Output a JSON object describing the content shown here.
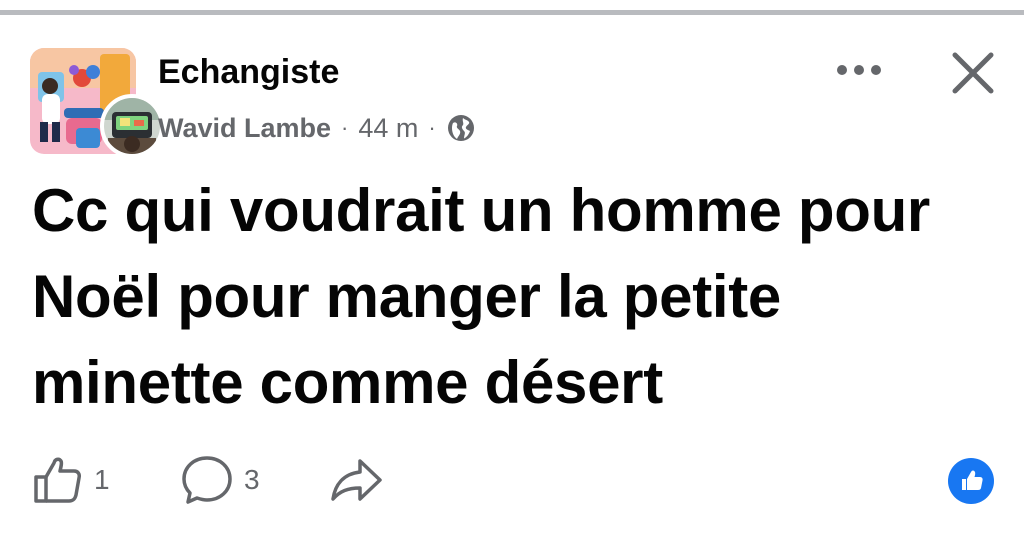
{
  "post": {
    "group_name": "Echangiste",
    "author_name": "Wavid Lambe",
    "time_ago": "44 m",
    "separator": "·",
    "text": "Cc qui voudrait un homme pour Noël pour manger la petite minette comme désert"
  },
  "actions": {
    "like_count": "1",
    "comment_count": "3"
  },
  "icons": {
    "more": "more-horizontal-icon",
    "close": "close-icon",
    "audience": "globe-icon",
    "like": "thumbs-up-outline-icon",
    "comment": "comment-bubble-icon",
    "share": "share-arrow-icon",
    "reaction": "like-reaction-icon"
  },
  "colors": {
    "accent": "#1877f2",
    "secondary_text": "#65676b",
    "primary_text": "#050505",
    "divider": "#b9bbbf"
  }
}
